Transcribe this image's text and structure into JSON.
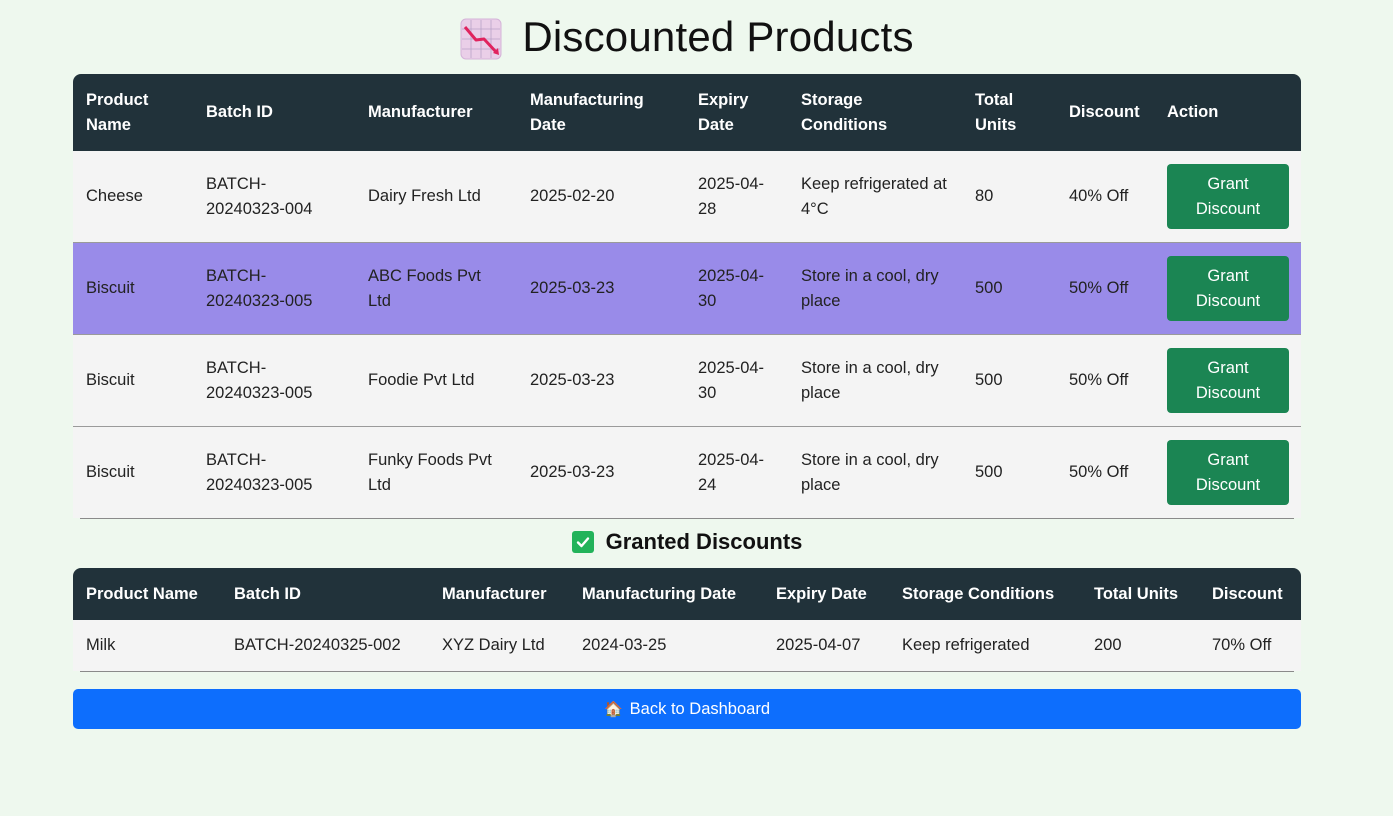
{
  "page_title": "Discounted Products",
  "title_icon": "chart-decreasing-icon",
  "discounted": {
    "columns": [
      "Product Name",
      "Batch ID",
      "Manufacturer",
      "Manufacturing Date",
      "Expiry Date",
      "Storage Conditions",
      "Total Units",
      "Discount",
      "Action"
    ],
    "rows": [
      {
        "product": "Cheese",
        "batch": "BATCH-20240323-004",
        "manufacturer": "Dairy Fresh Ltd",
        "mfg_date": "2025-02-20",
        "expiry": "2025-04-28",
        "storage": "Keep refrigerated at 4°C",
        "units": "80",
        "discount": "40% Off",
        "action": "Grant Discount"
      },
      {
        "product": "Biscuit",
        "batch": "BATCH-20240323-005",
        "manufacturer": "ABC Foods Pvt Ltd",
        "mfg_date": "2025-03-23",
        "expiry": "2025-04-30",
        "storage": "Store in a cool, dry place",
        "units": "500",
        "discount": "50% Off",
        "action": "Grant Discount"
      },
      {
        "product": "Biscuit",
        "batch": "BATCH-20240323-005",
        "manufacturer": "Foodie Pvt Ltd",
        "mfg_date": "2025-03-23",
        "expiry": "2025-04-30",
        "storage": "Store in a cool, dry place",
        "units": "500",
        "discount": "50% Off",
        "action": "Grant Discount"
      },
      {
        "product": "Biscuit",
        "batch": "BATCH-20240323-005",
        "manufacturer": "Funky Foods Pvt Ltd",
        "mfg_date": "2025-03-23",
        "expiry": "2025-04-24",
        "storage": "Store in a cool, dry place",
        "units": "500",
        "discount": "50% Off",
        "action": "Grant Discount"
      }
    ]
  },
  "granted": {
    "title": "Granted Discounts",
    "icon": "check-box-icon",
    "columns": [
      "Product Name",
      "Batch ID",
      "Manufacturer",
      "Manufacturing Date",
      "Expiry Date",
      "Storage Conditions",
      "Total Units",
      "Discount"
    ],
    "rows": [
      {
        "product": "Milk",
        "batch": "BATCH-20240325-002",
        "manufacturer": "XYZ Dairy Ltd",
        "mfg_date": "2024-03-25",
        "expiry": "2025-04-07",
        "storage": "Keep refrigerated",
        "units": "200",
        "discount": "70% Off"
      }
    ]
  },
  "back_button": {
    "label": "Back to Dashboard",
    "icon": "house-icon"
  },
  "colors": {
    "background": "#eef8ee",
    "header": "#21323a",
    "highlight_row": "#998be9",
    "grant_button": "#1b8553",
    "back_button": "#0d6efd",
    "check": "#22b35a"
  }
}
